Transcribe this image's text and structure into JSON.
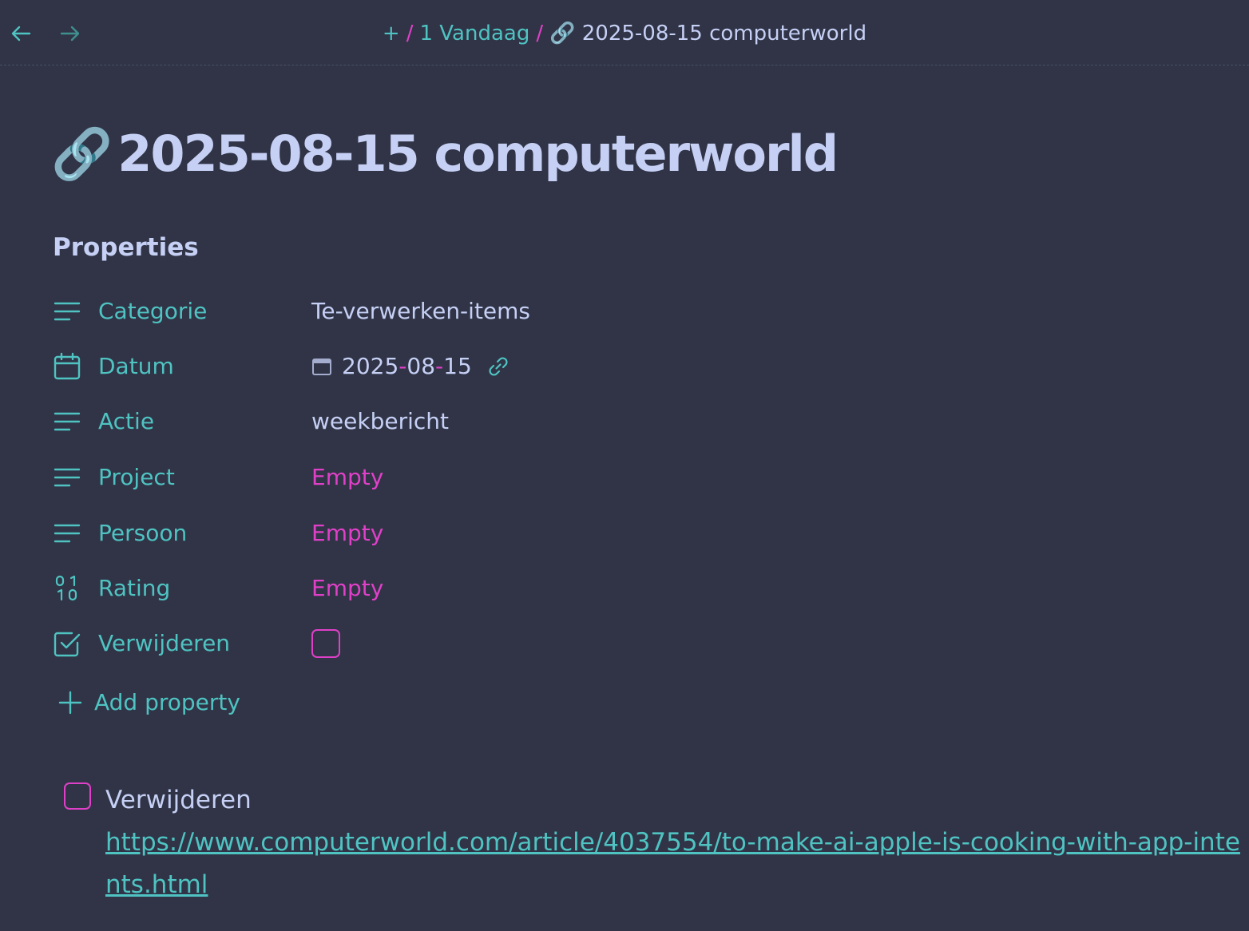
{
  "breadcrumb": {
    "plus": "+",
    "sep1": "/",
    "parent": "1 Vandaag",
    "sep2": "/",
    "current_emoji": "🔗",
    "current": "2025-08-15 computerworld"
  },
  "title": {
    "emoji": "🔗",
    "text": "2025-08-15 computerworld"
  },
  "properties": {
    "heading": "Properties",
    "rows": [
      {
        "icon": "text-lines-icon",
        "name": "Categorie",
        "value": "Te-verwerken-items"
      },
      {
        "icon": "calendar-icon",
        "name": "Datum",
        "value": {
          "year": "2025",
          "dash1": "-",
          "month": "08",
          "dash2": "-",
          "day": "15"
        }
      },
      {
        "icon": "text-lines-icon",
        "name": "Actie",
        "value": "weekbericht"
      },
      {
        "icon": "text-lines-icon",
        "name": "Project",
        "value": "Empty"
      },
      {
        "icon": "text-lines-icon",
        "name": "Persoon",
        "value": "Empty"
      },
      {
        "icon": "number-icon",
        "name": "Rating",
        "value": "Empty"
      },
      {
        "icon": "checkbox-icon",
        "name": "Verwijderen",
        "value": false
      }
    ],
    "add_label": "Add property"
  },
  "task": {
    "checked": false,
    "label": "Verwijderen",
    "url": "https://www.computerworld.com/article/4037554/to-make-ai-apple-is-cooking-with-app-intents.html"
  },
  "colors": {
    "background": "#303446",
    "text": "#c6d0f5",
    "accent_teal": "#4fc3c2",
    "accent_pink": "#e040c8"
  }
}
